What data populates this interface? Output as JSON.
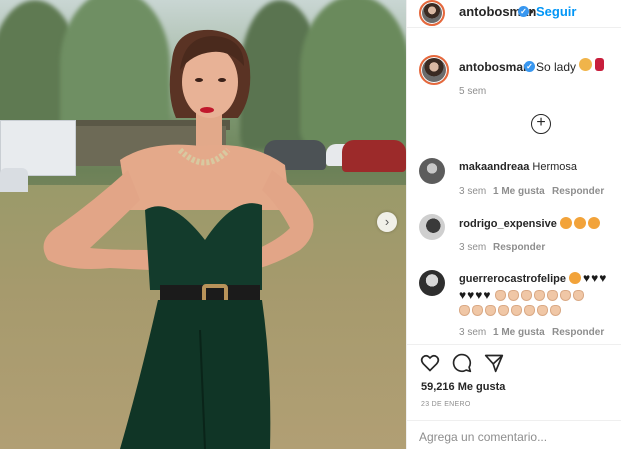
{
  "post": {
    "author": "antobosman",
    "follow_label": "Seguir",
    "follow_separator": "•",
    "next_glyph": "›",
    "caption_text": "So lady",
    "caption_time": "5 sem",
    "load_more_glyph": "+",
    "likes": "59,216 Me gusta",
    "date": "23 DE ENERO",
    "comment_placeholder": "Agrega un comentario..."
  },
  "comments": [
    {
      "user": "makaandreaa",
      "text": "Hermosa",
      "time": "3 sem",
      "likes": "1 Me gusta",
      "reply": "Responder"
    },
    {
      "user": "rodrigo_expensive",
      "text": "",
      "time": "3 sem",
      "likes": "",
      "reply": "Responder"
    },
    {
      "user": "guerrerocastrofelipe",
      "text": "",
      "time": "3 sem",
      "likes": "1 Me gusta",
      "reply": "Responder"
    }
  ],
  "icons": {
    "verified": "verified-badge-icon",
    "like": "heart-icon",
    "comment": "comment-bubble-icon",
    "share": "paper-plane-icon"
  },
  "colors": {
    "link_blue": "#0095f6",
    "verified_blue": "#3897f0",
    "muted_text": "#8e8e8e",
    "dress_green": "#133b2c"
  }
}
